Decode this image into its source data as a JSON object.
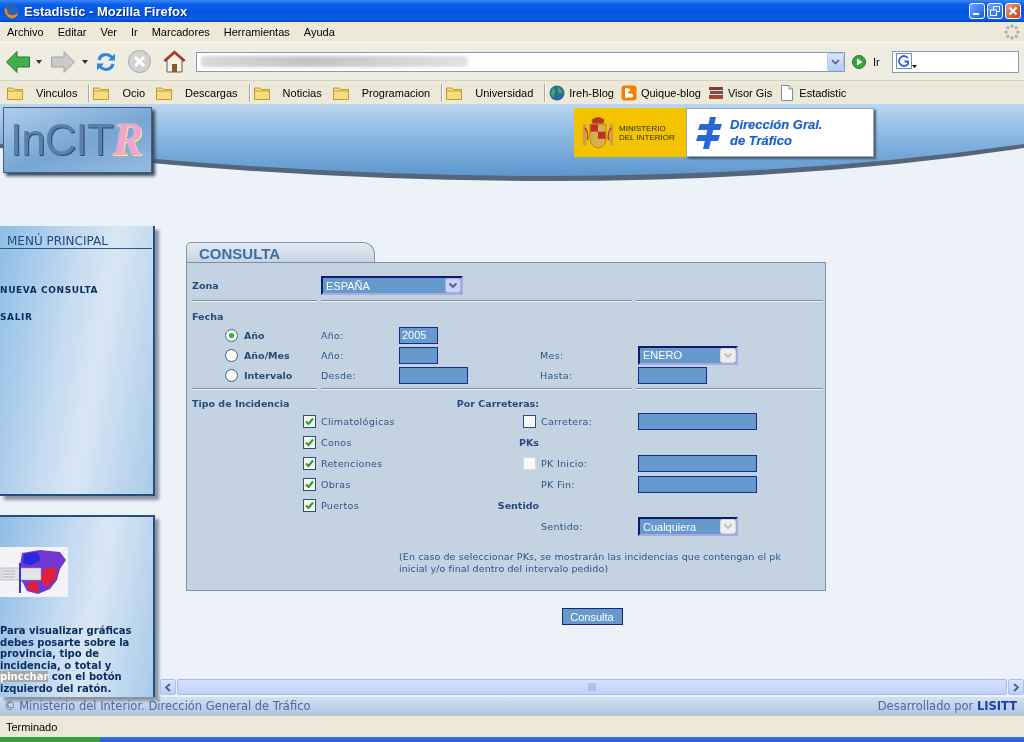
{
  "window": {
    "title": "Estadistic - Mozilla Firefox"
  },
  "menu": [
    "Archivo",
    "Editar",
    "Ver",
    "Ir",
    "Marcadores",
    "Herramientas",
    "Ayuda"
  ],
  "navigation": {
    "buttons": [
      {
        "kind": "back",
        "disabled": false
      },
      {
        "kind": "forward",
        "disabled": true
      },
      {
        "kind": "reload",
        "disabled": false
      },
      {
        "kind": "stop",
        "disabled": true
      },
      {
        "kind": "home",
        "disabled": false
      }
    ],
    "go_label": "Ir"
  },
  "bookmarks": [
    [
      {
        "kind": "folder",
        "label": "Vinculos"
      }
    ],
    [
      {
        "kind": "folder",
        "label": "Ocio"
      },
      {
        "kind": "folder",
        "label": "Descargas"
      }
    ],
    [
      {
        "kind": "folder",
        "label": "Noticias"
      },
      {
        "kind": "folder",
        "label": "Programacion"
      }
    ],
    [
      {
        "kind": "folder",
        "label": "Universidad"
      }
    ],
    [
      {
        "kind": "link",
        "label": "Ireh-Blog"
      },
      {
        "kind": "link",
        "label": "Quique-blog"
      },
      {
        "kind": "link",
        "label": "Visor Gis"
      },
      {
        "kind": "link",
        "label": "Estadistic"
      }
    ]
  ],
  "header": {
    "logo": {
      "text": "InCIT",
      "mark": "R"
    },
    "ministry": [
      "MINISTERIO",
      "DEL INTERIOR"
    ],
    "agency": [
      "Dirección Gral.",
      "de Tráfico"
    ]
  },
  "sidebar": {
    "menu_title": "MENÚ PRINCIPAL",
    "items": [
      "NUEVA CONSULTA",
      "SALIR"
    ],
    "help_text": [
      {
        "text": "Para visualizar gráficas debes posarte sobre la provincia, tipo de incidencia, o total y ",
        "highlighted": false
      },
      {
        "text": "pincchar",
        "highlighted": true
      },
      {
        "text": " con el botón izquierdo del ratón.",
        "highlighted": false
      }
    ]
  },
  "form": {
    "tab": "CONSULTA",
    "zona": {
      "label": "Zona",
      "value": "ESPAÑA",
      "disabled": false
    },
    "fecha": {
      "label": "Fecha",
      "options": [
        {
          "label": "Año",
          "selected": true,
          "fields": [
            {
              "kind": "year",
              "label": "Año:",
              "value": "2005"
            }
          ]
        },
        {
          "label": "Año/Mes",
          "selected": false,
          "fields": [
            {
              "kind": "year",
              "label": "Año:"
            },
            {
              "kind": "select",
              "label": "Mes:",
              "value": "ENERO",
              "disabled": true
            }
          ]
        },
        {
          "label": "Intervalo",
          "selected": false,
          "fields": [
            {
              "kind": "date",
              "label": "Desde:"
            },
            {
              "kind": "date",
              "label": "Hasta:"
            }
          ]
        }
      ]
    },
    "incidencias": {
      "label": "Tipo de Incidencia",
      "items": [
        {
          "label": "Climatológicas",
          "checked": true
        },
        {
          "label": "Conos",
          "checked": true
        },
        {
          "label": "Retenciones",
          "checked": true
        },
        {
          "label": "Obras",
          "checked": true
        },
        {
          "label": "Puertos",
          "checked": true
        }
      ]
    },
    "carreteras": [
      {
        "kind": "heading",
        "label": "Por Carreteras:"
      },
      {
        "kind": "toggle_input",
        "label": "Carretera:",
        "checked": false,
        "disabled": false
      },
      {
        "kind": "heading",
        "label": "PKs"
      },
      {
        "kind": "toggle_input",
        "label": "PK Inicio:",
        "checked": false,
        "disabled": true
      },
      {
        "kind": "input",
        "label": "PK Fin:"
      },
      {
        "kind": "heading",
        "label": "Sentido"
      },
      {
        "kind": "select",
        "label": "Sentido:",
        "value": "Cualquiera",
        "disabled": true
      }
    ],
    "note": "(En caso de seleccionar PKs, se mostrarán las incidencias que contengan el pk inicial y/o final dentro del intervalo pedido)",
    "submit": "Consulta"
  },
  "footer": {
    "copyright": "© Ministerio del Interior. Dirección General de Tráfico",
    "credit": "Desarrollado por **LISITT**"
  },
  "status_bar": "Terminado"
}
